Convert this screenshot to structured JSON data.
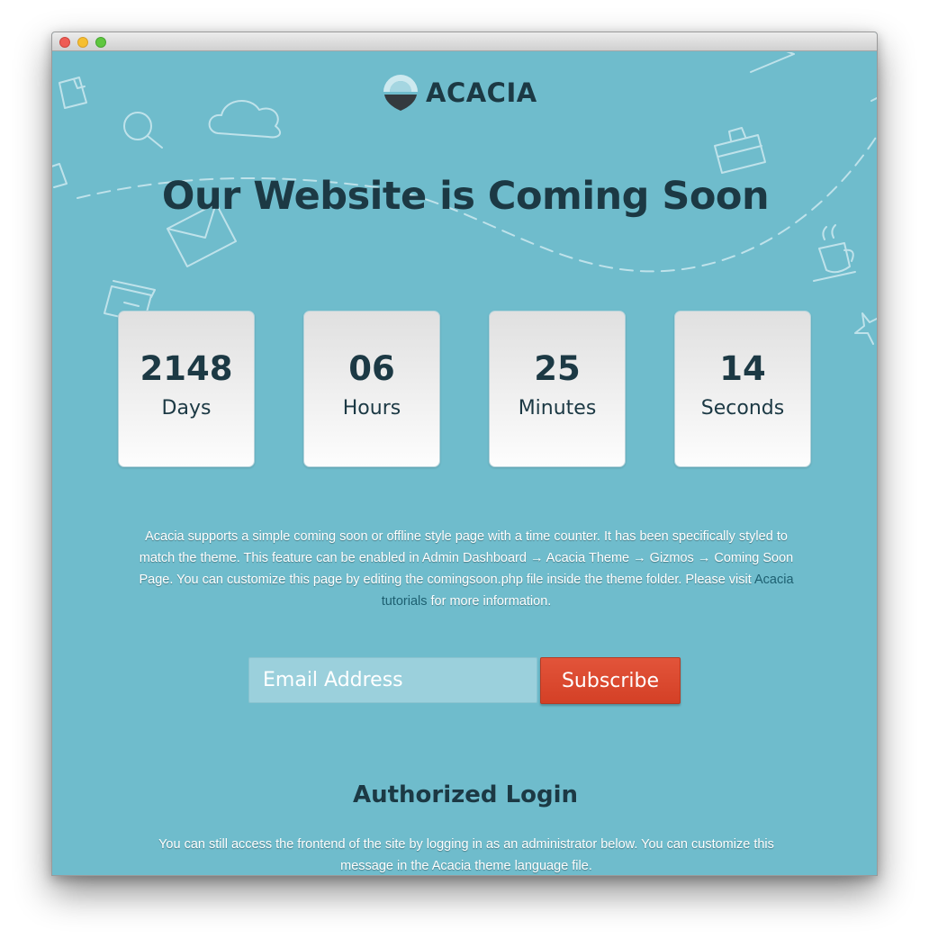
{
  "brand": {
    "name": "ACACIA"
  },
  "headline": "Our Website is Coming Soon",
  "countdown": [
    {
      "value": "2148",
      "label": "Days"
    },
    {
      "value": "06",
      "label": "Hours"
    },
    {
      "value": "25",
      "label": "Minutes"
    },
    {
      "value": "14",
      "label": "Seconds"
    }
  ],
  "description": {
    "before_link": "Acacia supports a simple coming soon or offline style page with a time counter. It has been specifically styled to match the theme. This feature can be enabled in Admin Dashboard → Acacia Theme → Gizmos → Coming Soon Page. You can customize this page by editing the comingsoon.php file inside the theme folder. Please visit ",
    "link_text": "Acacia tutorials",
    "after_link": " for more information."
  },
  "subscribe_form": {
    "email_placeholder": "Email Address",
    "button_label": "Subscribe"
  },
  "auth": {
    "title": "Authorized Login",
    "text": "You can still access the frontend of the site by logging in as an administrator below. You can customize this message in the Acacia theme language file."
  },
  "colors": {
    "background": "#6fbccc",
    "heading": "#1c3944",
    "button": "#d94a30",
    "link": "#1d5f70"
  },
  "icons": [
    "file-icon",
    "search-icon",
    "cloud-icon",
    "envelope-icon",
    "box-icon",
    "briefcase-icon",
    "coffee-cup-icon",
    "star-icon",
    "paper-plane-icon"
  ]
}
